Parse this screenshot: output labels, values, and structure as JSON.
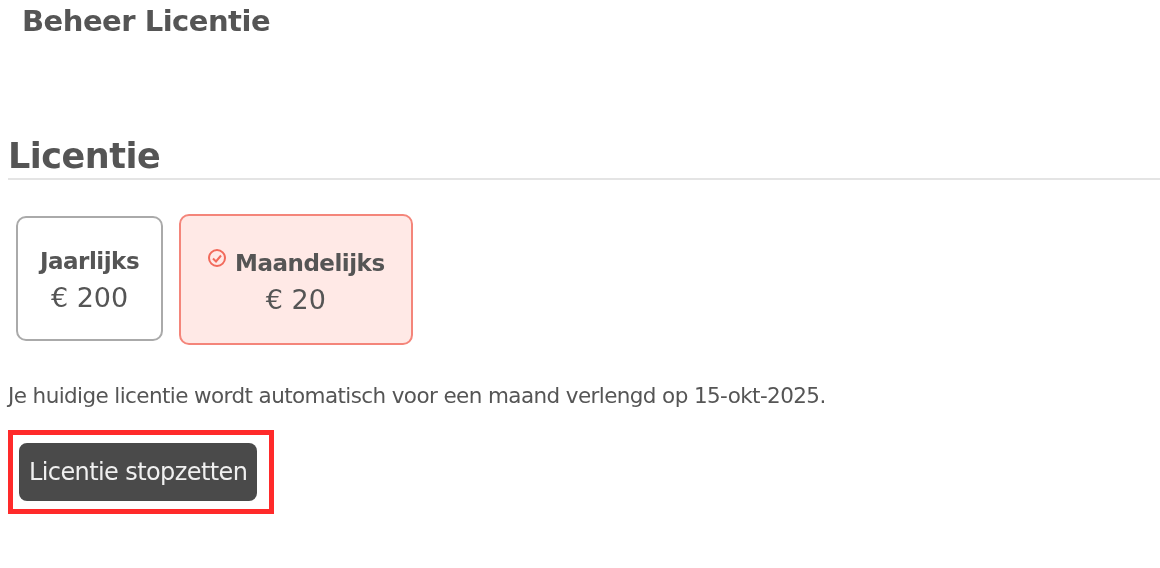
{
  "page_title": "Beheer Licentie",
  "section": {
    "heading": "Licentie",
    "plans": [
      {
        "name": "Jaarlijks",
        "price": "€ 200",
        "selected": false
      },
      {
        "name": "Maandelijks",
        "price": "€ 20",
        "selected": true
      }
    ],
    "notice": "Je huidige licentie wordt automatisch voor een maand verlengd op 15-okt-2025.",
    "button": {
      "label": "Licentie stopzetten",
      "highlighted": true
    }
  }
}
